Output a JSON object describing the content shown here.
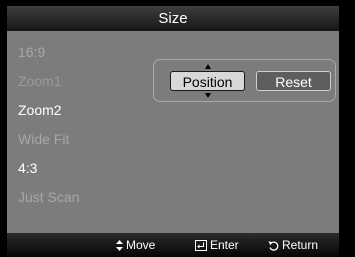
{
  "title": "Size",
  "size_options": [
    {
      "label": "16:9",
      "state": "dim"
    },
    {
      "label": "Zoom1",
      "state": "disabled"
    },
    {
      "label": "Zoom2",
      "state": "active"
    },
    {
      "label": "Wide Fit",
      "state": "dim"
    },
    {
      "label": "4:3",
      "state": "active"
    },
    {
      "label": "Just Scan",
      "state": "dim"
    }
  ],
  "adjust_panel": {
    "position_label": "Position",
    "reset_label": "Reset",
    "selected": "Position"
  },
  "footer": {
    "move": {
      "icon": "up-down-arrows-icon",
      "label": "Move"
    },
    "enter": {
      "icon": "enter-icon",
      "label": "Enter"
    },
    "return": {
      "icon": "return-icon",
      "label": "Return"
    }
  },
  "colors": {
    "panel_bg": "#7c7c7c",
    "bar_bg": "#161616",
    "text_active": "#ffffff",
    "text_dim": "#a7a7a7",
    "selected_button_bg": "#d8d8d8"
  }
}
